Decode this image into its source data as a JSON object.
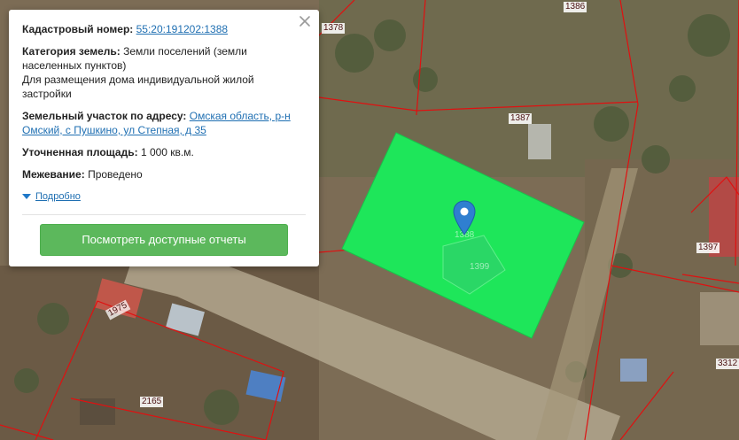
{
  "popup": {
    "cadastral_label": "Кадастровый номер:",
    "cadastral_number": "55:20:191202:1388",
    "category_label": "Категория земель:",
    "category_value": "Земли поселений (земли населенных пунктов)",
    "permitted_use": "Для размещения дома индивидуальной жилой застройки",
    "address_label": "Земельный участок по адресу:",
    "address_value": "Омская область, р-н Омский, с Пушкино, ул Степная, д 35",
    "area_label": "Уточненная площадь:",
    "area_value": "1 000 кв.м.",
    "survey_label": "Межевание:",
    "survey_value": "Проведено",
    "details_link": "Подробно",
    "reports_button": "Посмотреть доступные отчеты"
  },
  "parcel_labels": {
    "p1386": "1386",
    "p1378": "1378",
    "p1387": "1387",
    "p1397": "1397",
    "p1388": "1388",
    "p1399": "1399",
    "p1975": "1975",
    "p2165": "2165",
    "p3312": "3312"
  },
  "colors": {
    "selected_parcel": "#1ee65a",
    "parcel_border": "#e01010",
    "button": "#5cb85c",
    "link": "#1f6fb2",
    "pin": "#2f7fd0"
  }
}
